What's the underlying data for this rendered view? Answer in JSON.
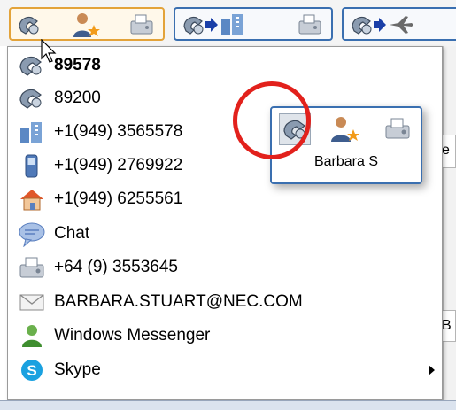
{
  "menu": {
    "items": [
      {
        "icon": "extension-phone-icon",
        "label": "89578",
        "bold": true
      },
      {
        "icon": "extension-phone-icon",
        "label": "89200"
      },
      {
        "icon": "office-building-icon",
        "label": "+1(949) 3565578"
      },
      {
        "icon": "mobile-phone-icon",
        "label": "+1(949) 2769922"
      },
      {
        "icon": "home-icon",
        "label": "+1(949) 6255561"
      },
      {
        "icon": "chat-bubble-icon",
        "label": "Chat"
      },
      {
        "icon": "fax-icon",
        "label": "+64 (9) 3553645"
      },
      {
        "icon": "envelope-icon",
        "label": "BARBARA.STUART@NEC.COM"
      },
      {
        "icon": "messenger-person-icon",
        "label": "Windows Messenger"
      },
      {
        "icon": "skype-icon",
        "label": "Skype",
        "submenu": true
      }
    ]
  },
  "contact_card": {
    "name": "Barbara S"
  },
  "background": {
    "right_fragment_1": "e",
    "right_fragment_2": "B"
  },
  "colors": {
    "tile_border": "#3a6fb0",
    "active_tile_border": "#e3a33a",
    "highlight_ring": "#e2211c"
  }
}
